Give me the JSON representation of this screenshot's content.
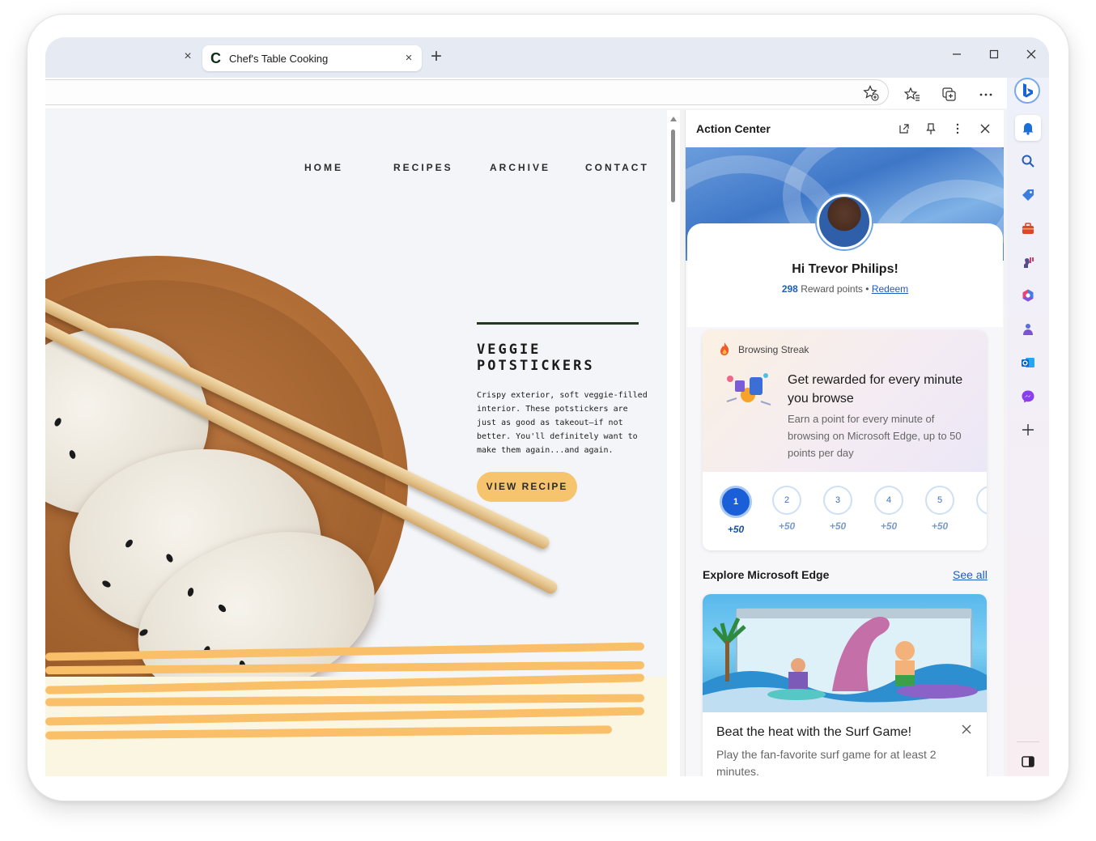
{
  "browser": {
    "tab_title": "Chef's Table Cooking",
    "tab_favicon": "C",
    "new_tab_icon": "+",
    "inactive_tab_close": "×",
    "active_tab_close": "×"
  },
  "window_controls": {
    "minimize": "—",
    "maximize": "☐",
    "close": "✕"
  },
  "toolbar_icons": [
    "add-favorite-icon",
    "favorites-icon",
    "collections-icon",
    "more-icon"
  ],
  "site": {
    "nav": [
      "HOME",
      "RECIPES",
      "ARCHIVE",
      "CONTACT"
    ],
    "recipe_title": "VEGGIE POTSTICKERS",
    "recipe_desc": "Crispy exterior, soft veggie-filled interior. These potstickers are just as good as takeout—if not better. You'll definitely want to make them again...and again.",
    "cta": "VIEW RECIPE",
    "colors": {
      "accent": "#f7c46e",
      "line": "#1f3a1f",
      "sauce": "#f9bf69"
    }
  },
  "action_center": {
    "title": "Action Center",
    "greeting": "Hi Trevor Philips!",
    "points": "298",
    "points_label": "Reward points",
    "separator": "•",
    "redeem": "Redeem",
    "streak": {
      "label": "Browsing Streak",
      "heading": "Get rewarded for every minute you browse",
      "body": "Earn a point for every minute of browsing on Microsoft Edge, up to 50 points per day",
      "days": [
        {
          "num": "1",
          "pts": "+50"
        },
        {
          "num": "2",
          "pts": "+50"
        },
        {
          "num": "3",
          "pts": "+50"
        },
        {
          "num": "4",
          "pts": "+50"
        },
        {
          "num": "5",
          "pts": "+50"
        }
      ],
      "more_pts": "+"
    },
    "explore_title": "Explore Microsoft Edge",
    "see_all": "See all",
    "game_title": "Beat the heat with the Surf Game!",
    "game_desc": "Play the fan-favorite surf game for at least 2 minutes."
  },
  "sidebar_icons": [
    "bell-icon",
    "search-icon",
    "shopping-tag-icon",
    "tools-icon",
    "games-icon",
    "microsoft365-icon",
    "drop-icon",
    "outlook-icon",
    "messenger-icon",
    "add-icon",
    "sidebar-toggle-icon"
  ]
}
